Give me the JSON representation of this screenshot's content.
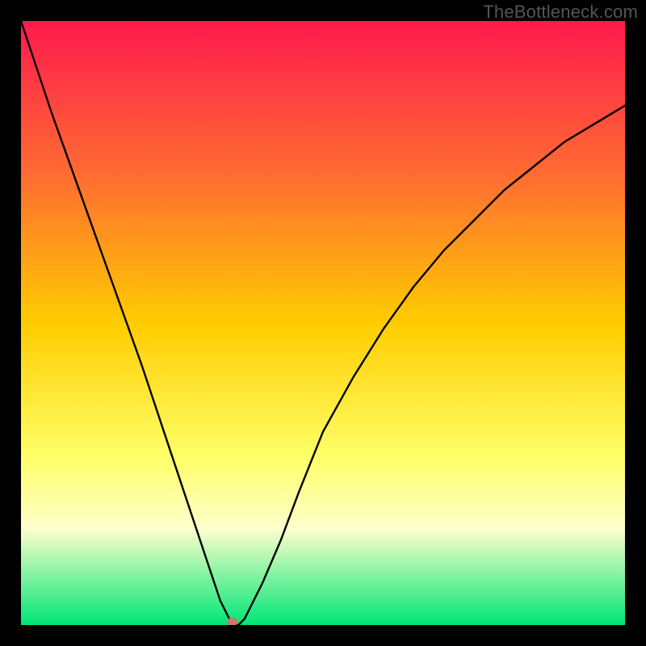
{
  "watermark": {
    "text": "TheBottleneck.com"
  },
  "chart_data": {
    "type": "line",
    "title": "",
    "xlabel": "",
    "ylabel": "",
    "xlim": [
      0,
      100
    ],
    "ylim": [
      0,
      100
    ],
    "background": {
      "type": "vertical-gradient",
      "stops": [
        {
          "pct": 0,
          "color": "#ff1a4d"
        },
        {
          "pct": 25,
          "color": "#ff6a33"
        },
        {
          "pct": 50,
          "color": "#ffcc00"
        },
        {
          "pct": 72,
          "color": "#ffff66"
        },
        {
          "pct": 84,
          "color": "#ffffcc"
        },
        {
          "pct": 100,
          "color": "#00e676"
        }
      ]
    },
    "series": [
      {
        "name": "bottleneck-curve",
        "color": "#000000",
        "x": [
          0,
          5,
          10,
          15,
          20,
          25,
          28,
          30,
          31,
          32,
          33,
          34,
          34.5,
          35,
          36,
          37,
          38,
          40,
          43,
          46,
          50,
          55,
          60,
          65,
          70,
          75,
          80,
          85,
          90,
          95,
          100
        ],
        "values": [
          100,
          85,
          71,
          57,
          43,
          28,
          19,
          13,
          10,
          7,
          4,
          2,
          1,
          0,
          0,
          1,
          3,
          7,
          14,
          22,
          32,
          41,
          49,
          56,
          62,
          67,
          72,
          76,
          80,
          83,
          86
        ]
      }
    ],
    "marker": {
      "x": 35,
      "y": 0,
      "color": "#c97a6e"
    },
    "grid": false,
    "legend": false
  }
}
